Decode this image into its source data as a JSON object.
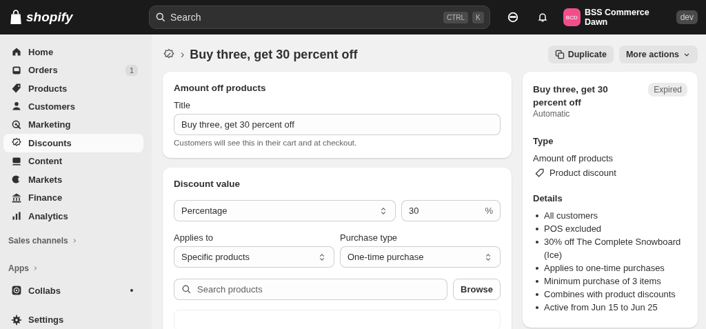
{
  "topbar": {
    "logo": "shopify",
    "search": {
      "placeholder": "Search",
      "shortcut": [
        "CTRL",
        "K"
      ]
    },
    "store": {
      "initials": "BCD",
      "name": "BSS Commerce Dawn",
      "badge": "dev"
    }
  },
  "sidebar": {
    "items": [
      {
        "label": "Home",
        "selected": false
      },
      {
        "label": "Orders",
        "selected": false,
        "count": "1"
      },
      {
        "label": "Products",
        "selected": false
      },
      {
        "label": "Customers",
        "selected": false
      },
      {
        "label": "Marketing",
        "selected": false
      },
      {
        "label": "Discounts",
        "selected": true
      },
      {
        "label": "Content",
        "selected": false
      },
      {
        "label": "Markets",
        "selected": false
      },
      {
        "label": "Finance",
        "selected": false
      },
      {
        "label": "Analytics",
        "selected": false
      }
    ],
    "sales_channels": "Sales channels",
    "apps": "Apps",
    "app_items": [
      {
        "label": "Collabs",
        "unread": true
      }
    ],
    "settings": "Settings"
  },
  "page": {
    "breadcrumb_sep": "›",
    "title": "Buy three, get 30 percent off",
    "actions": [
      "Duplicate",
      "More actions"
    ]
  },
  "amount_card": {
    "heading": "Amount off products",
    "title_label": "Title",
    "title_value": "Buy three, get 30 percent off",
    "help": "Customers will see this in their cart and at checkout."
  },
  "value_card": {
    "heading": "Discount value",
    "value_type": "Percentage",
    "amount": "30",
    "suffix": "%",
    "applies_label": "Applies to",
    "applies_value": "Specific products",
    "purchase_label": "Purchase type",
    "purchase_value": "One-time purchase",
    "search_placeholder": "Search products",
    "browse": "Browse"
  },
  "summary": {
    "title": "Buy three, get 30 percent off",
    "status": "Expired",
    "method": "Automatic",
    "type_heading": "Type",
    "type": "Amount off products",
    "class": "Product discount",
    "details_heading": "Details",
    "details": [
      "All customers",
      "POS excluded",
      "30% off The Complete Snowboard (Ice)",
      "Applies to one-time purchases",
      "Minimum purchase of 3 items",
      "Combines with product discounts",
      "Active from Jun 15 to Jun 25"
    ]
  }
}
